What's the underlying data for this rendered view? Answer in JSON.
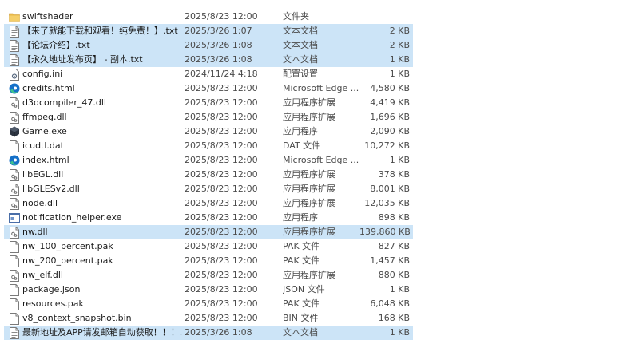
{
  "colors": {
    "selection": "#cce4f7",
    "folder": "#e8b84a",
    "edge_blue": "#1570c8",
    "edge_green": "#3ec28f"
  },
  "files": [
    {
      "name": "swiftshader",
      "date": "2025/8/23 12:00",
      "type": "文件夹",
      "size": "",
      "icon": "folder-icon",
      "selected": false
    },
    {
      "name": "【来了就能下载和观看！纯免费！】.txt",
      "date": "2025/3/26 1:07",
      "type": "文本文档",
      "size": "2 KB",
      "icon": "text-file-icon",
      "selected": true
    },
    {
      "name": "【论坛介绍】.txt",
      "date": "2025/3/26 1:08",
      "type": "文本文档",
      "size": "2 KB",
      "icon": "text-file-icon",
      "selected": true
    },
    {
      "name": "【永久地址发布页】 - 副本.txt",
      "date": "2025/3/26 1:08",
      "type": "文本文档",
      "size": "1 KB",
      "icon": "text-file-icon",
      "selected": true
    },
    {
      "name": "config.ini",
      "date": "2024/11/24 4:18",
      "type": "配置设置",
      "size": "1 KB",
      "icon": "config-file-icon",
      "selected": false
    },
    {
      "name": "credits.html",
      "date": "2025/8/23 12:00",
      "type": "Microsoft Edge ...",
      "size": "4,580 KB",
      "icon": "edge-icon",
      "selected": false
    },
    {
      "name": "d3dcompiler_47.dll",
      "date": "2025/8/23 12:00",
      "type": "应用程序扩展",
      "size": "4,419 KB",
      "icon": "dll-file-icon",
      "selected": false
    },
    {
      "name": "ffmpeg.dll",
      "date": "2025/8/23 12:00",
      "type": "应用程序扩展",
      "size": "1,696 KB",
      "icon": "dll-file-icon",
      "selected": false
    },
    {
      "name": "Game.exe",
      "date": "2025/8/23 12:00",
      "type": "应用程序",
      "size": "2,090 KB",
      "icon": "game-exe-icon",
      "selected": false
    },
    {
      "name": "icudtl.dat",
      "date": "2025/8/23 12:00",
      "type": "DAT 文件",
      "size": "10,272 KB",
      "icon": "blank-file-icon",
      "selected": false
    },
    {
      "name": "index.html",
      "date": "2025/8/23 12:00",
      "type": "Microsoft Edge ...",
      "size": "1 KB",
      "icon": "edge-icon",
      "selected": false
    },
    {
      "name": "libEGL.dll",
      "date": "2025/8/23 12:00",
      "type": "应用程序扩展",
      "size": "378 KB",
      "icon": "dll-file-icon",
      "selected": false
    },
    {
      "name": "libGLESv2.dll",
      "date": "2025/8/23 12:00",
      "type": "应用程序扩展",
      "size": "8,001 KB",
      "icon": "dll-file-icon",
      "selected": false
    },
    {
      "name": "node.dll",
      "date": "2025/8/23 12:00",
      "type": "应用程序扩展",
      "size": "12,035 KB",
      "icon": "dll-file-icon",
      "selected": false
    },
    {
      "name": "notification_helper.exe",
      "date": "2025/8/23 12:00",
      "type": "应用程序",
      "size": "898 KB",
      "icon": "exe-window-icon",
      "selected": false
    },
    {
      "name": "nw.dll",
      "date": "2025/8/23 12:00",
      "type": "应用程序扩展",
      "size": "139,860 KB",
      "icon": "dll-file-icon",
      "selected": true
    },
    {
      "name": "nw_100_percent.pak",
      "date": "2025/8/23 12:00",
      "type": "PAK 文件",
      "size": "827 KB",
      "icon": "blank-file-icon",
      "selected": false
    },
    {
      "name": "nw_200_percent.pak",
      "date": "2025/8/23 12:00",
      "type": "PAK 文件",
      "size": "1,457 KB",
      "icon": "blank-file-icon",
      "selected": false
    },
    {
      "name": "nw_elf.dll",
      "date": "2025/8/23 12:00",
      "type": "应用程序扩展",
      "size": "880 KB",
      "icon": "dll-file-icon",
      "selected": false
    },
    {
      "name": "package.json",
      "date": "2025/8/23 12:00",
      "type": "JSON 文件",
      "size": "1 KB",
      "icon": "blank-file-icon",
      "selected": false
    },
    {
      "name": "resources.pak",
      "date": "2025/8/23 12:00",
      "type": "PAK 文件",
      "size": "6,048 KB",
      "icon": "blank-file-icon",
      "selected": false
    },
    {
      "name": "v8_context_snapshot.bin",
      "date": "2025/8/23 12:00",
      "type": "BIN 文件",
      "size": "168 KB",
      "icon": "blank-file-icon",
      "selected": false
    },
    {
      "name": "最新地址及APP请发邮箱自动获取！！！....",
      "date": "2025/3/26 1:08",
      "type": "文本文档",
      "size": "1 KB",
      "icon": "text-file-icon",
      "selected": true
    }
  ]
}
